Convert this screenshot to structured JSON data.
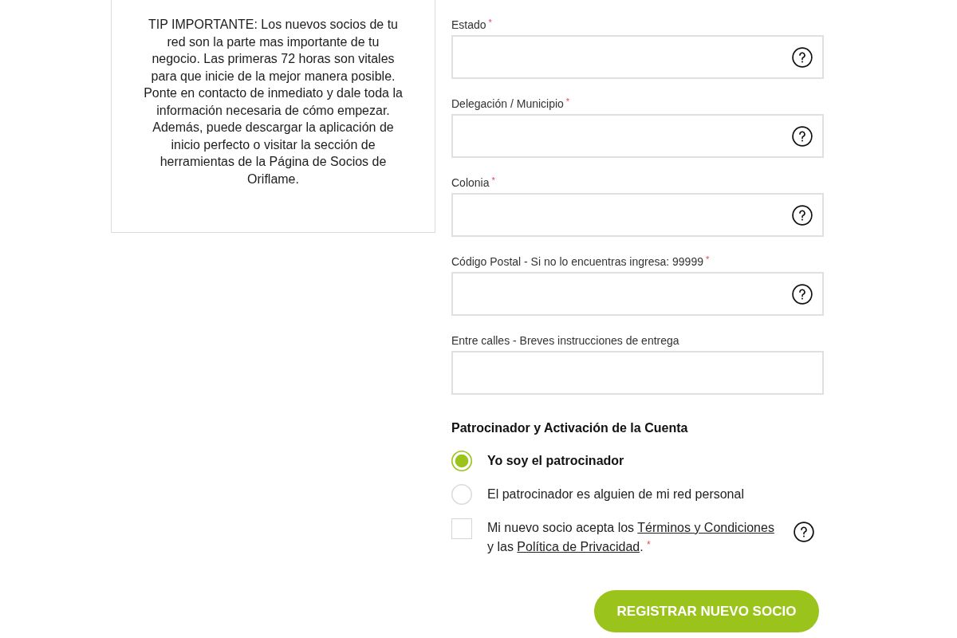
{
  "tip_box": {
    "text": "TIP IMPORTANTE: Los nuevos socios de tu red son la parte mas importante de tu negocio. Las primeras 72 horas son vitales para que inicie de la mejor manera posible. Ponte en contacto de inmediato y dale toda la información necesaria de cómo empezar. Además, puede descargar la aplicación de inicio perfecto o visitar la sección de herramientas de la Página de Socios de Oriflame."
  },
  "address_fields": [
    {
      "label": "Estado",
      "required_mark": "*",
      "help": true
    },
    {
      "label": "Delegación / Municipio",
      "required_mark": "*",
      "help": true
    },
    {
      "label": "Colonia",
      "required_mark": "*",
      "help": true
    },
    {
      "label": "Código Postal - Si no lo encuentras ingresa: 99999",
      "required_mark": "*",
      "help": true
    },
    {
      "label": "Entre calles - Breves instrucciones de entrega",
      "help": false
    }
  ],
  "sponsor": {
    "heading": "Patrocinador y Activación de la Cuenta",
    "options": [
      {
        "label": "Yo soy el patrocinador",
        "selected": true
      },
      {
        "label": "El patrocinador es alguien de mi red personal",
        "selected": false
      }
    ]
  },
  "consent": {
    "checked": false,
    "segments": [
      {
        "kind": "text",
        "text": "Mi nuevo socio acepta los "
      },
      {
        "kind": "link",
        "text": "Términos y Condiciones"
      },
      {
        "kind": "text",
        "text": " y las "
      },
      {
        "kind": "link",
        "text": "Política de Privacidad"
      },
      {
        "kind": "text",
        "text": ". "
      },
      {
        "kind": "required",
        "text": "*"
      }
    ],
    "help": true
  },
  "submit_button": {
    "label": "REGISTRAR NUEVO SOCIO"
  }
}
